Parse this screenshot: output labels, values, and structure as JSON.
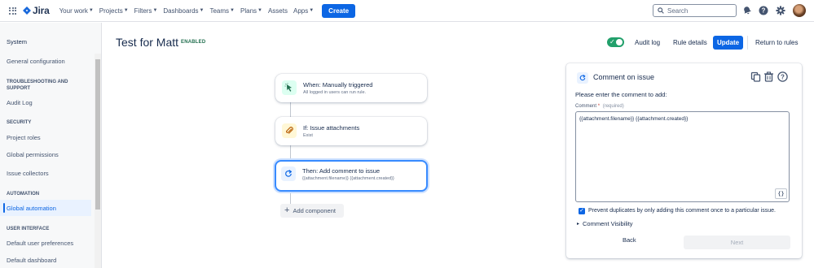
{
  "topnav": {
    "logo_text": "Jira",
    "items": [
      {
        "label": "Your work",
        "has_dropdown": true
      },
      {
        "label": "Projects",
        "has_dropdown": true
      },
      {
        "label": "Filters",
        "has_dropdown": true
      },
      {
        "label": "Dashboards",
        "has_dropdown": true
      },
      {
        "label": "Teams",
        "has_dropdown": true
      },
      {
        "label": "Plans",
        "has_dropdown": true
      },
      {
        "label": "Assets",
        "has_dropdown": false
      },
      {
        "label": "Apps",
        "has_dropdown": true
      }
    ],
    "create_label": "Create",
    "search_placeholder": "Search",
    "icons": [
      "notifications-icon",
      "help-icon",
      "settings-icon",
      "avatar"
    ]
  },
  "sidebar": {
    "heading": "System",
    "general": "General configuration",
    "troubleshooting_section": "TROUBLESHOOTING AND SUPPORT",
    "audit_log": "Audit Log",
    "security_section": "SECURITY",
    "project_roles": "Project roles",
    "global_permissions": "Global permissions",
    "issue_collectors": "Issue collectors",
    "automation_section": "AUTOMATION",
    "global_automation": "Global automation",
    "user_interface_section": "USER INTERFACE",
    "default_user_preferences": "Default user preferences",
    "default_dashboard": "Default dashboard"
  },
  "header": {
    "title": "Test for Matt",
    "status_badge": "ENABLED",
    "rule_enabled": true,
    "audit_log": "Audit log",
    "rule_details": "Rule details",
    "update": "Update",
    "return_to_rules": "Return to rules"
  },
  "flow": {
    "trigger": {
      "title": "When: Manually triggered",
      "subtitle": "All logged in users can run rule."
    },
    "condition": {
      "title": "If: Issue attachments",
      "subtitle": "Exist"
    },
    "action": {
      "title": "Then: Add comment to issue",
      "subtitle": "{{attachment.filename}} {{attachment.created}}"
    },
    "add_component": "Add component"
  },
  "panel": {
    "title": "Comment on issue",
    "prompt": "Please enter the comment to add:",
    "field_label": "Comment",
    "required_mark": "*",
    "required_text": "(required)",
    "comment_value": "{{attachment.filename}} {{attachment.created}}",
    "smart_values_button": "{}",
    "prevent_duplicates_label": "Prevent duplicates by only adding this comment once to a particular issue.",
    "prevent_duplicates_checked": true,
    "visibility_label": "Comment Visibility",
    "back": "Back",
    "next": "Next"
  },
  "colors": {
    "primary": "#0c66e4",
    "enabled_green": "#22a06b",
    "selected_border": "#388bff"
  }
}
